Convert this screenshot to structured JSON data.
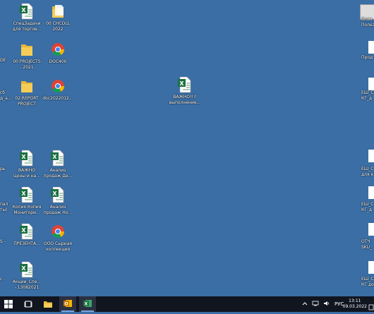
{
  "desktop": {
    "icons": [
      {
        "label": "СпецЗадачи\nдля торгов...",
        "icon": "excel-file-icon"
      },
      {
        "label": "00 CHCOLL\n2022",
        "icon": "folder-icon"
      },
      {
        "label": "00 PROJECTS\n- 2021",
        "icon": "folder-icon"
      },
      {
        "label": "DOC400",
        "icon": "chrome-icon"
      },
      {
        "label": "02 REPORT\nPROJECT",
        "icon": "folder-icon"
      },
      {
        "label": "doc2022012...",
        "icon": "chrome-icon"
      },
      {
        "label": "ВАЖНО!!!!\nвыполнение...",
        "icon": "excel-file-icon"
      },
      {
        "label": "ВАЖНО\nЦены и на...",
        "icon": "excel-file-icon"
      },
      {
        "label": "Анализ\nпродаж Де...",
        "icon": "excel-file-icon"
      },
      {
        "label": "Копия Копия\nМонитори...",
        "icon": "excel-file-icon"
      },
      {
        "label": "Анализ\nпродаж Но...",
        "icon": "excel-file-icon"
      },
      {
        "label": "ПРЕЗЕНТА...",
        "icon": "excel-file-icon"
      },
      {
        "label": "ООО Сырная\nколлекция",
        "icon": "chrome-icon"
      },
      {
        "label": "Акции_Спе...\n- 13082021",
        "icon": "excel-file-icon"
      }
    ],
    "left_edge": [
      "DE",
      "сб\nд_а...",
      "рь",
      "пал\nты)",
      "S -",
      "с -"
    ],
    "right_edge": [
      "Возм\nПолез",
      "Прод",
      "ЕШ_С\nКГ_д",
      "ЕШ_С\nдля к",
      "ЕШ_С\nКГ_д",
      "ОТЧ\nSKU_",
      "ЕШ_С\nКГ до"
    ]
  },
  "taskbar": {
    "items": [
      {
        "name": "start-button",
        "icon": "windows-logo-icon"
      },
      {
        "name": "task-view-button",
        "icon": "task-view-icon"
      },
      {
        "name": "explorer-button",
        "icon": "folder-icon"
      },
      {
        "name": "outlook-button",
        "icon": "outlook-icon"
      },
      {
        "name": "excel-button",
        "icon": "excel-icon"
      }
    ],
    "language": "РУС",
    "time": "13:11",
    "date": "09.03.2022"
  }
}
